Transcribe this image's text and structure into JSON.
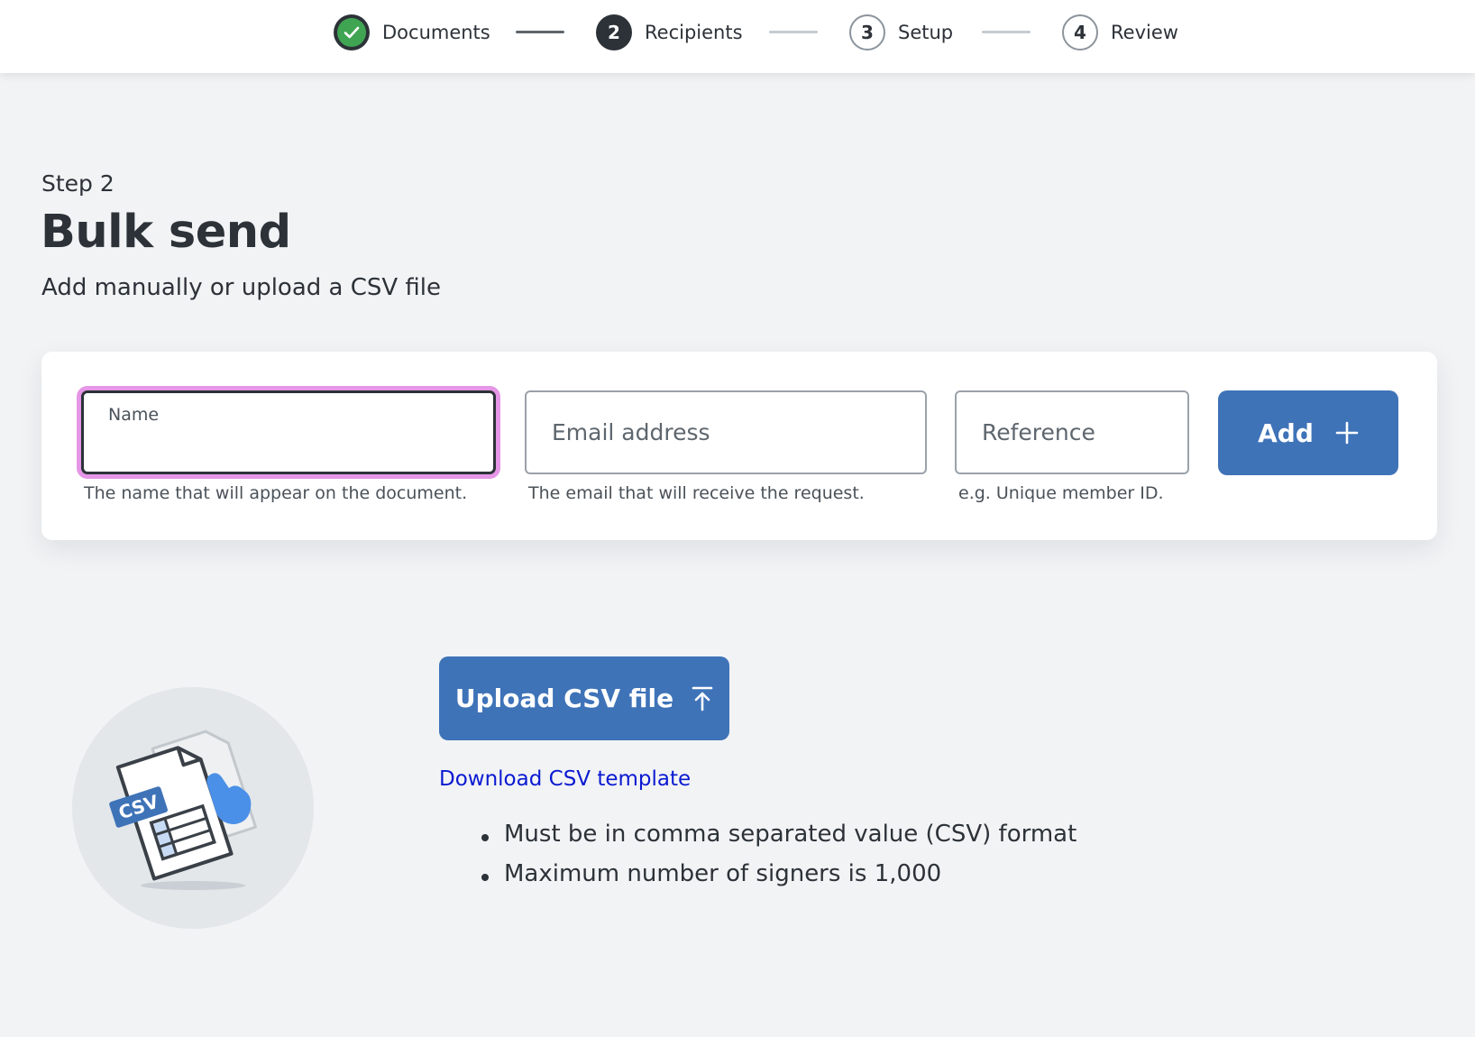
{
  "stepper": {
    "steps": [
      {
        "number": "",
        "label": "Documents",
        "state": "done",
        "icon": "check-icon"
      },
      {
        "number": "2",
        "label": "Recipients",
        "state": "current"
      },
      {
        "number": "3",
        "label": "Setup",
        "state": "todo"
      },
      {
        "number": "4",
        "label": "Review",
        "state": "todo"
      }
    ]
  },
  "heading": {
    "kicker": "Step 2",
    "title": "Bulk send",
    "subtitle": "Add manually or upload a CSV file"
  },
  "manual_entry": {
    "name": {
      "label": "Name",
      "value": "",
      "hint": "The name that will appear on the document."
    },
    "email": {
      "placeholder": "Email address",
      "value": "",
      "hint": "The email that will receive the request."
    },
    "reference": {
      "placeholder": "Reference",
      "value": "",
      "hint": "e.g. Unique member ID."
    },
    "add_button": {
      "label": "Add",
      "icon": "plus-icon"
    }
  },
  "upload": {
    "button_label": "Upload CSV file",
    "button_icon": "upload-arrow-icon",
    "download_link": "Download CSV template",
    "illustration_badge": "CSV",
    "rules": [
      "Must be in comma separated value (CSV) format",
      "Maximum number of signers is 1,000"
    ]
  },
  "colors": {
    "primary": "#3f73b8",
    "done_green": "#3fa552",
    "focus_ring": "#e596e6",
    "link": "#0a1ad1",
    "text": "#2c3238",
    "page_bg": "#f2f3f5"
  }
}
